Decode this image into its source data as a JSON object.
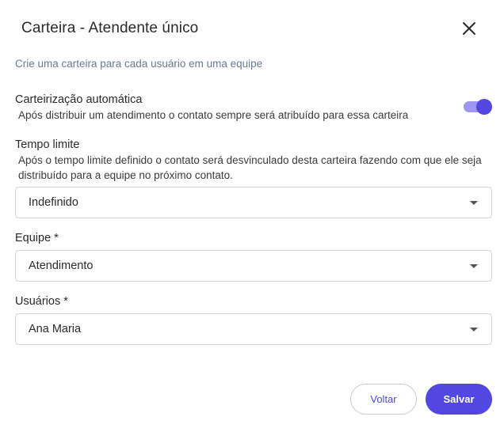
{
  "dialog": {
    "title": "Carteira - Atendente único",
    "subtitle": "Crie uma carteira para cada usuário em uma equipe"
  },
  "auto_assign": {
    "label": "Carteirização automática",
    "description": "Após distribuir um atendimento o contato sempre será atribuído para essa carteira",
    "enabled": true
  },
  "time_limit": {
    "label": "Tempo limite",
    "description": "Após o tempo limite definido o contato será desvinculado desta carteira fazendo com que ele seja distribuído para a equipe no próximo contato.",
    "value": "Indefinido"
  },
  "team": {
    "label": "Equipe *",
    "value": "Atendimento"
  },
  "users": {
    "label": "Usuários *",
    "value": "Ana Maria"
  },
  "actions": {
    "back_label": "Voltar",
    "save_label": "Salvar"
  },
  "colors": {
    "accent": "#5247e0",
    "toggle_track": "#9e97f2"
  }
}
